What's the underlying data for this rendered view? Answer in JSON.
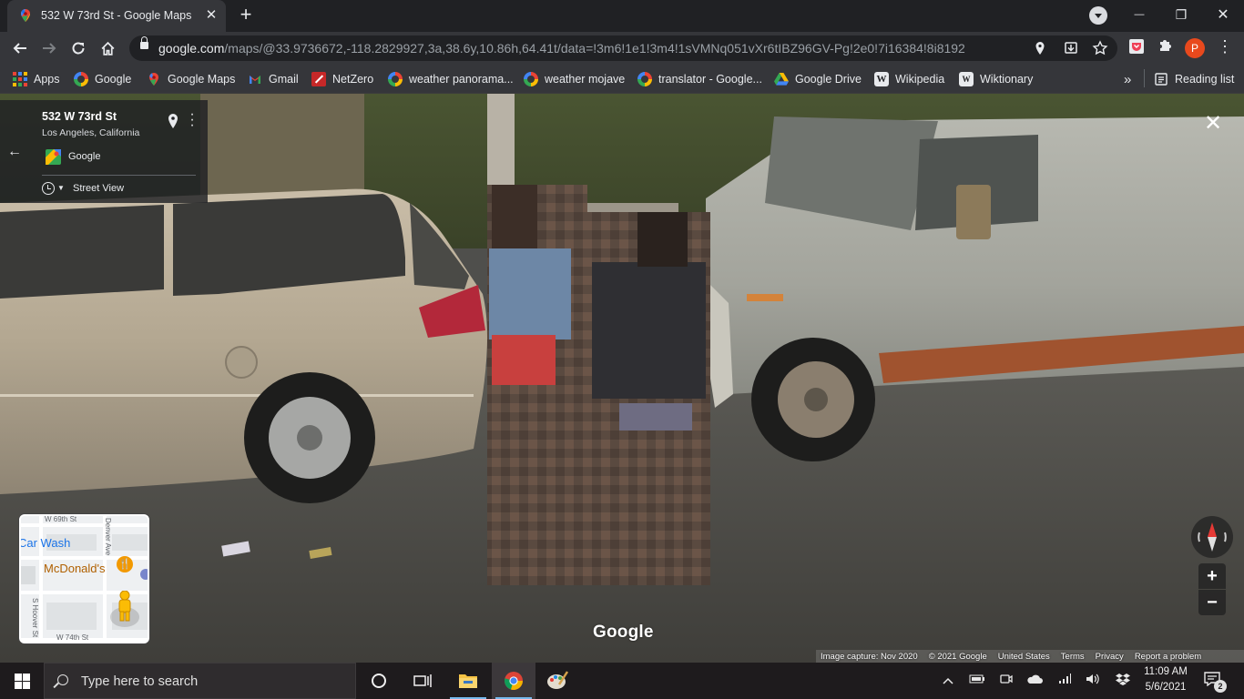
{
  "browser": {
    "tab": {
      "title": "532 W 73rd St - Google Maps",
      "favicon": "google-maps-pin-icon"
    },
    "new_tab": "+",
    "window_controls": {
      "minimize": "—",
      "restore": "❐",
      "close": "✕"
    },
    "url": {
      "host": "google.com",
      "path": "/maps/@33.9736672,-118.2829927,3a,38.6y,10.86h,64.41t/data=!3m6!1e1!3m4!1sVMNq051vXr6tIBZ96GV-Pg!2e0!7i16384!8i8192"
    },
    "profile_initial": "P",
    "bookmarks": [
      {
        "label": "Apps",
        "icon": "apps-grid-icon"
      },
      {
        "label": "Google",
        "icon": "google-icon"
      },
      {
        "label": "Google Maps",
        "icon": "google-maps-pin-icon"
      },
      {
        "label": "Gmail",
        "icon": "gmail-icon"
      },
      {
        "label": "NetZero",
        "icon": "netzero-icon"
      },
      {
        "label": "weather panorama...",
        "icon": "google-icon"
      },
      {
        "label": "weather mojave",
        "icon": "google-icon"
      },
      {
        "label": "translator - Google...",
        "icon": "google-icon"
      },
      {
        "label": "Google Drive",
        "icon": "google-drive-icon"
      },
      {
        "label": "Wikipedia",
        "icon": "wikipedia-icon"
      },
      {
        "label": "Wiktionary",
        "icon": "wiktionary-icon"
      }
    ],
    "more_bookmarks": "»",
    "reading_list": "Reading list"
  },
  "streetview": {
    "address": "532 W 73rd St",
    "city": "Los Angeles, California",
    "source": "Google",
    "mode": "Street View",
    "watermark": "Google",
    "minimap": {
      "streets": [
        "W 69th St",
        "Denver Ave",
        "S Hoover St",
        "W 74th St"
      ],
      "pois": [
        "Car Wash",
        "McDonald's"
      ]
    },
    "footer": [
      "Image capture: Nov 2020",
      "© 2021 Google",
      "United States",
      "Terms",
      "Privacy",
      "Report a problem"
    ],
    "zoom_in": "+",
    "zoom_out": "−"
  },
  "taskbar": {
    "search_placeholder": "Type here to search",
    "time": "11:09 AM",
    "date": "5/6/2021",
    "notification_count": "2"
  }
}
